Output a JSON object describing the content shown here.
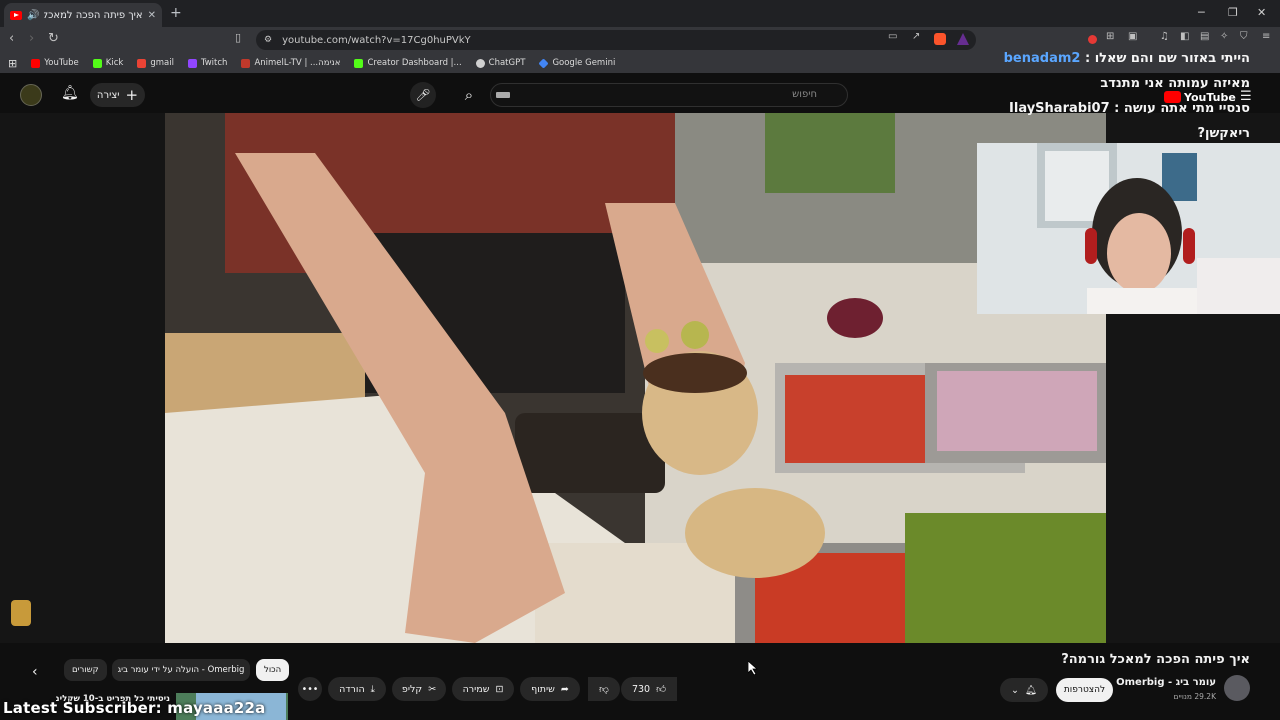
{
  "browser": {
    "tab_title": "איך פיתה הפכה למאכל גורמה?",
    "url": "youtube.com/watch?v=17Cg0huPVkY",
    "bookmarks": [
      {
        "label": "YouTube",
        "color": "#ff0000"
      },
      {
        "label": "Kick",
        "color": "#53fc18"
      },
      {
        "label": "gmail",
        "color": "#ea4335"
      },
      {
        "label": "Twitch",
        "color": "#9146ff"
      },
      {
        "label": "AnimelL-TV | ...אנימה",
        "color": "#c0392b"
      },
      {
        "label": "Creator Dashboard |...",
        "color": "#53fc18"
      },
      {
        "label": "ChatGPT",
        "color": "#d0d0d0"
      },
      {
        "label": "Google Gemini",
        "color": "#4285f4"
      }
    ]
  },
  "youtube": {
    "search_placeholder": "חיפוש",
    "create_label": "יצירה"
  },
  "stream_overlay": {
    "chat": [
      {
        "user": "benadam2",
        "message": "הייתי באזור שם והם שאלו"
      },
      {
        "user": "",
        "message": "מאיזה עמותה אני מתנדב"
      },
      {
        "user": "IlaySharabi07",
        "message": "סנסיי מתי אתה עושה"
      },
      {
        "user": "",
        "message": "ריאקשן?"
      }
    ],
    "youtube_brand": "YouTube",
    "latest_subscriber_text": "Latest Subscriber: mayaaa22a"
  },
  "video": {
    "title": "איך פיתה הפכה למאכל גורמה?",
    "channel_name": "עומר ביג - Omerbig",
    "subscribers": "29.2K מנויים",
    "subscribe_label": "להצטרפות",
    "likes": "730",
    "share_label": "שיתוף",
    "save_label": "שמירה",
    "clip_label": "קליפ",
    "download_label": "הורדה",
    "chips": [
      "הכול",
      "הועלה על ידי עומר ביג - Omerbig",
      "קשורים"
    ],
    "recommended_title": "ניסיתי כל תפריט ב-10 שקלים!!!"
  }
}
